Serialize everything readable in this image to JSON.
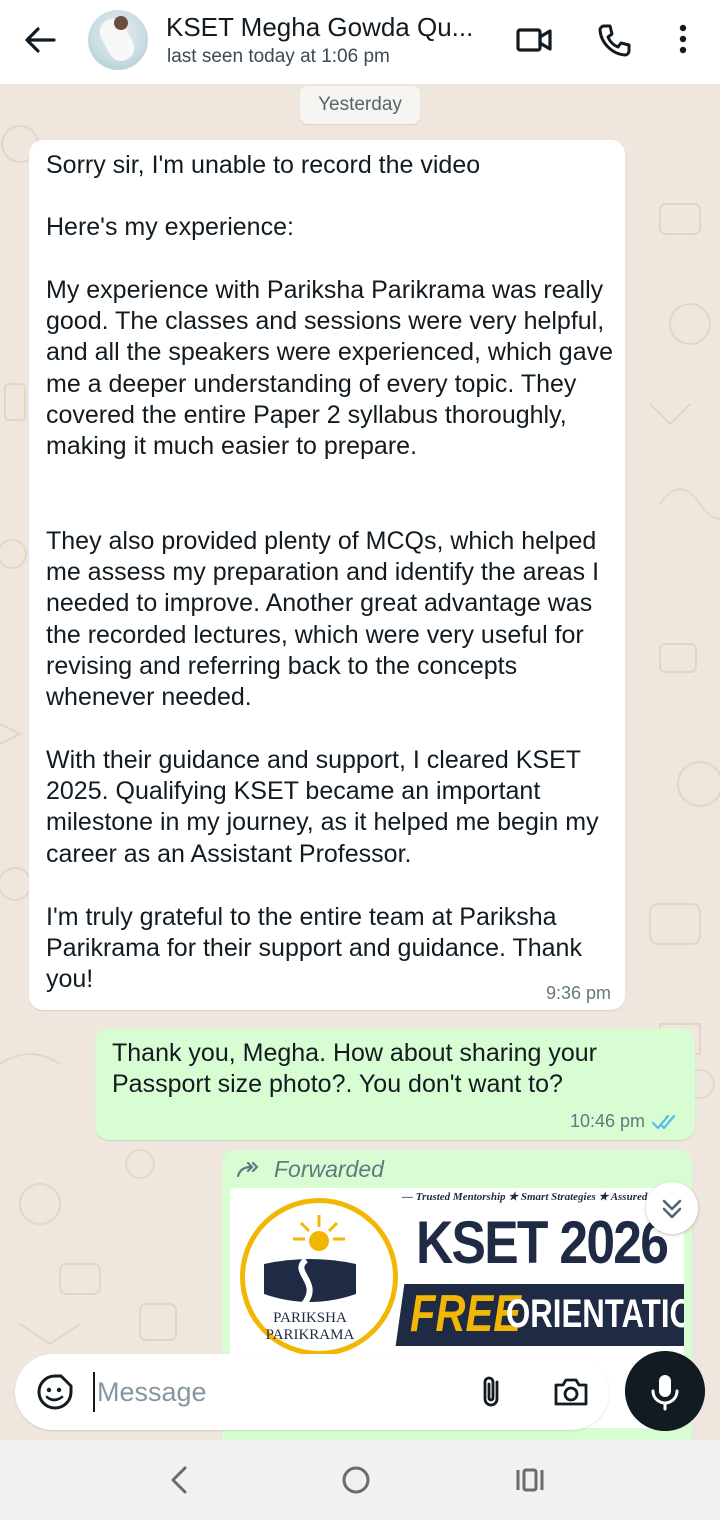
{
  "header": {
    "contact_name": "KSET Megha Gowda Qu...",
    "status": "last seen today at 1:06 pm",
    "icons": [
      "back-arrow-icon",
      "video-call-icon",
      "voice-call-icon",
      "more-options-icon"
    ]
  },
  "chat": {
    "date_divider": "Yesterday",
    "incoming": {
      "paragraphs": [
        "Sorry sir, I'm unable to record the video",
        "Here's my experience:",
        "My experience with Pariksha Parikrama was really good. The classes and sessions were very helpful, and all the speakers were experienced, which gave me a deeper understanding of every topic. They covered the entire Paper 2 syllabus thoroughly, making it much easier to prepare.",
        "They also provided plenty of MCQs, which helped me assess my preparation and identify the areas I needed to improve. Another great advantage was the recorded lectures, which were very useful for revising and referring back to the concepts whenever needed.",
        "With their guidance and support, I cleared KSET 2025. Qualifying KSET became an important milestone in my journey, as it helped me begin my career as an Assistant Professor.",
        "I'm truly grateful to the entire team at Pariksha Parikrama for their support and guidance. Thank you!"
      ],
      "time": "9:36 pm"
    },
    "outgoing": {
      "text": "Thank you, Megha. How about sharing your Passport size photo?.  You don't want to?",
      "time": "10:46 pm",
      "status": "read"
    },
    "forwarded": {
      "label": "Forwarded",
      "banner": {
        "tagline": "— Trusted Mentorship ★ Smart Strategies ★ Assured Success",
        "logo_line1": "PARIKSHA",
        "logo_line2": "PARIKRAMA",
        "headline": "KSET 2026",
        "strip_highlight": "FREE",
        "strip_rest": "ORIENTATION"
      }
    }
  },
  "composer": {
    "placeholder": "Message"
  },
  "colors": {
    "incoming_bubble": "#ffffff",
    "outgoing_bubble": "#d9fdd3",
    "chat_background": "#efe7dd",
    "read_ticks": "#53bdeb",
    "brand_navy": "#1f2a44",
    "brand_gold": "#f2b705"
  }
}
